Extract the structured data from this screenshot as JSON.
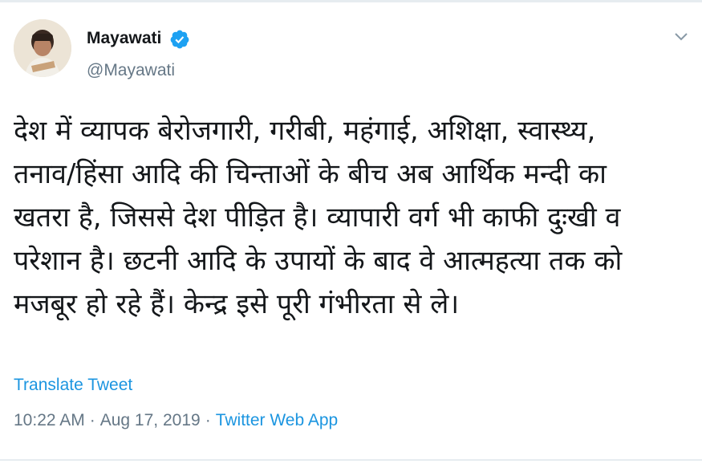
{
  "tweet": {
    "author": {
      "name": "Mayawati",
      "handle": "@Mayawati",
      "verified": true
    },
    "text_lines": [
      "देश में व्यापक बेरोजगारी, गरीबी, महंगाई, अशिक्षा, स्वास्थ्य,",
      "तनाव/हिंसा आदि की चिन्ताओं के बीच अब आर्थिक मन्दी का",
      "खतरा है, जिससे देश पीड़ित है। व्यापारी वर्ग भी काफी दुःखी व",
      "परेशान है। छटनी आदि के उपायों के बाद वे आत्महत्या तक को",
      "मजबूर हो रहे हैं। केन्द्र इसे पूरी गंभीरता से ले।"
    ],
    "translate_label": "Translate Tweet",
    "time": "10:22 AM",
    "separator": "·",
    "date": "Aug 17, 2019",
    "source": "Twitter Web App"
  },
  "icons": {
    "verified": "verified-badge-icon",
    "menu": "chevron-down-icon"
  },
  "colors": {
    "link": "#1b95e0",
    "secondary_text": "#657786",
    "primary_text": "#14171a"
  }
}
